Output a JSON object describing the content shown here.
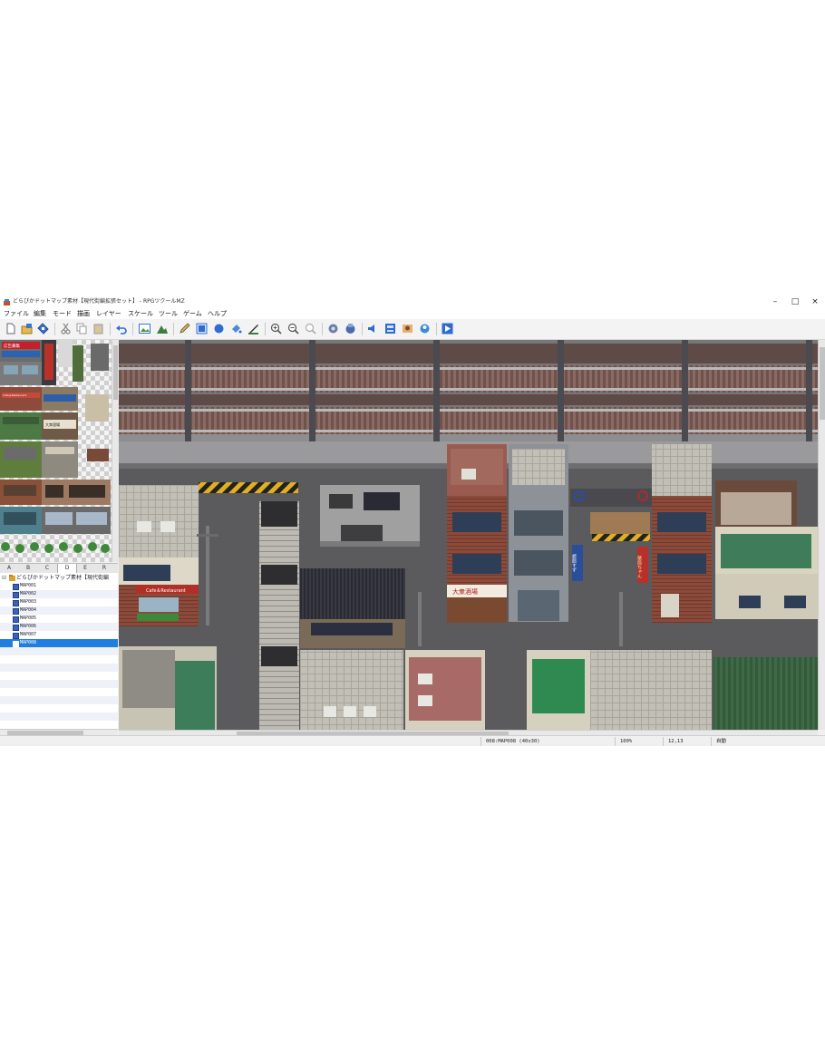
{
  "window": {
    "title": "どらぴかドットマップ素材【現代街編拡張セット】 - RPGツクールMZ",
    "controls": {
      "minimize": "–",
      "maximize": "□",
      "close": "×"
    }
  },
  "menu": [
    "ファイル",
    "編集",
    "モード",
    "描画",
    "レイヤー",
    "スケール",
    "ツール",
    "ゲーム",
    "ヘルプ"
  ],
  "toolbar": {
    "icons": [
      "new-project-icon",
      "open-project-icon",
      "save-project-icon",
      "cut-icon",
      "copy-icon",
      "paste-icon",
      "undo-icon",
      "map-mode-icon",
      "event-mode-icon",
      "pencil-icon",
      "rectangle-icon",
      "ellipse-icon",
      "flood-fill-icon",
      "shadow-pen-icon",
      "zoom-in-icon",
      "zoom-out-icon",
      "actual-size-icon",
      "database-icon",
      "plugin-manager-icon",
      "sound-test-icon",
      "event-searcher-icon",
      "character-generator-icon",
      "resource-manager-icon",
      "playtest-icon"
    ]
  },
  "palette": {
    "signs": [
      "広告募集",
      "Cafe＆Restaurant",
      "大衆酒場"
    ],
    "tabs": [
      "A",
      "B",
      "C",
      "D",
      "E",
      "R"
    ],
    "active_tab": "D"
  },
  "tree": {
    "root": "どらぴかドットマップ素材【現代街編",
    "maps": [
      "MAP001",
      "MAP002",
      "MAP003",
      "MAP004",
      "MAP005",
      "MAP006",
      "MAP007",
      "MAP008"
    ],
    "selected": "MAP008"
  },
  "map": {
    "signs": {
      "cafe": "Cafe＆Restaurant",
      "izakaya": "大衆酒場",
      "vertical_blue": "旅館すず",
      "vertical_red": "薬局ちゃん"
    }
  },
  "status": {
    "map": "008:MAP008 (40x30)",
    "zoom": "100%",
    "coords": "12,13",
    "mode": "自動"
  },
  "colors": {
    "selection": "#1e7fe0",
    "map_background": "#555555",
    "rail": "#7a5a55",
    "roof_green": "#3f7d5a"
  }
}
